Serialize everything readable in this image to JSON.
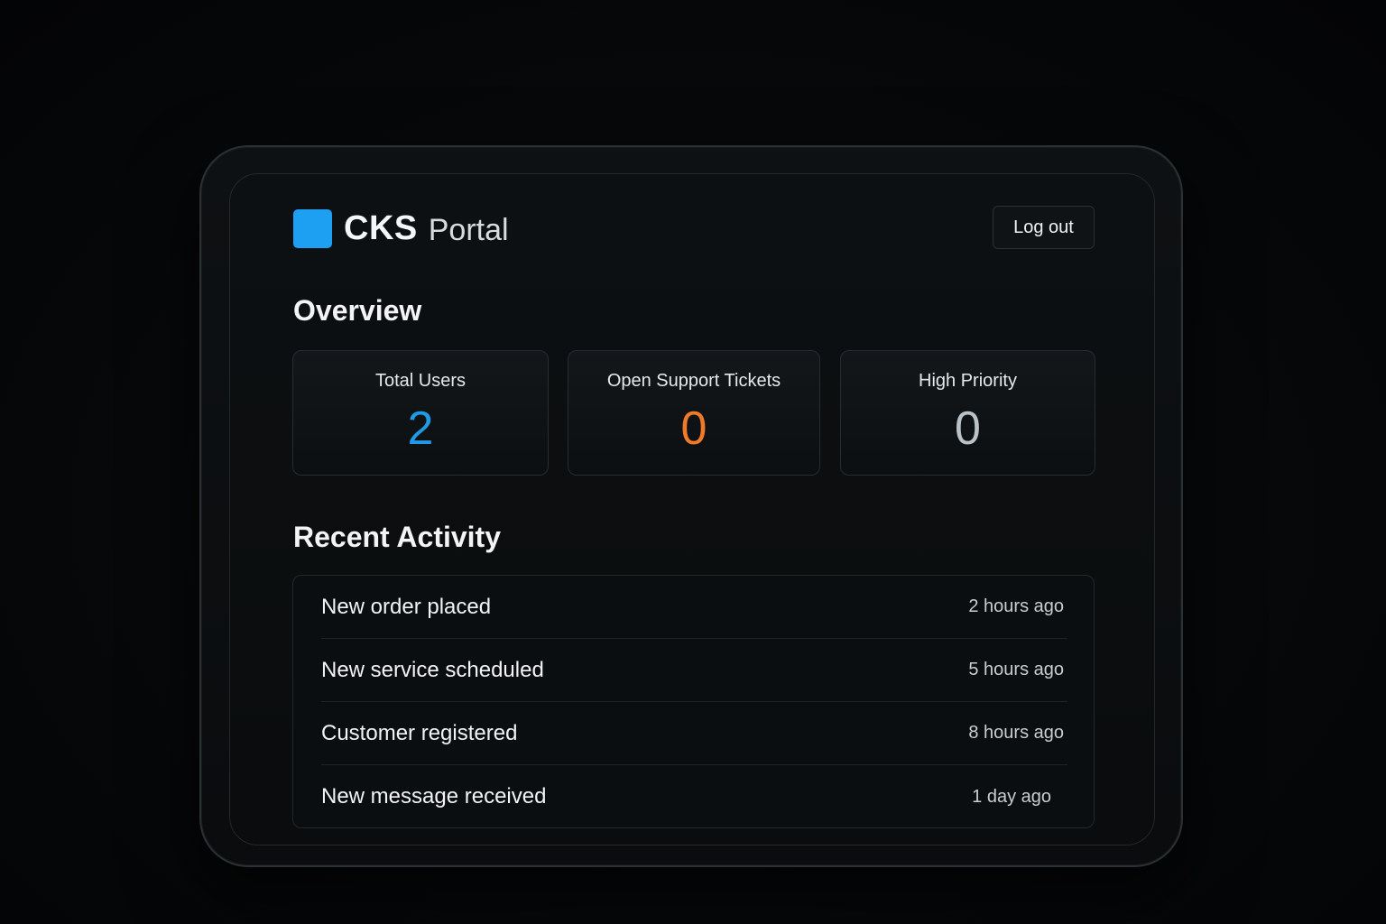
{
  "app": {
    "brand_name": "CKS",
    "brand_sub": "Portal",
    "logout_label": "Log out"
  },
  "overview": {
    "title": "Overview",
    "cards": [
      {
        "label": "Total Users",
        "value": "2",
        "color": "#1e9ae6"
      },
      {
        "label": "Open Support Tickets",
        "value": "0",
        "color": "#f07a2a"
      },
      {
        "label": "High Priority",
        "value": "0",
        "color": "#b9c2c8"
      }
    ]
  },
  "activity": {
    "title": "Recent Activity",
    "items": [
      {
        "text": "New order placed",
        "time": "2 hours ago"
      },
      {
        "text": "New service scheduled",
        "time": "5 hours ago"
      },
      {
        "text": "Customer registered",
        "time": "8 hours ago"
      },
      {
        "text": "New message received",
        "time": "1 day ago"
      }
    ]
  },
  "colors": {
    "accent": "#1ea0f2",
    "background": "#050708"
  }
}
